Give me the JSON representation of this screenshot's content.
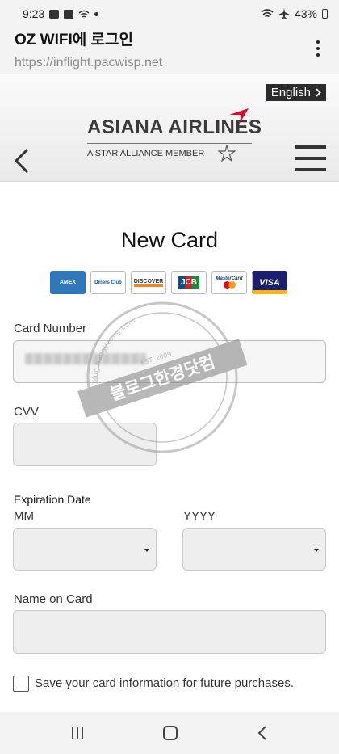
{
  "status_bar": {
    "time": "9:23",
    "battery": "43%"
  },
  "browser": {
    "page_title": "OZ WIFI에 로그인",
    "url": "https://inflight.pacwisp.net"
  },
  "header": {
    "language_label": "English",
    "airline_name": "ASIANA AIRLINES",
    "alliance_text": "A STAR ALLIANCE MEMBER"
  },
  "form": {
    "title": "New Card",
    "card_brands": [
      "AMEX",
      "Diners Club",
      "DISCOVER",
      "JCB",
      "MasterCard",
      "VISA"
    ],
    "card_number_label": "Card Number",
    "cvv_label": "CVV",
    "expiration_label": "Expiration Date",
    "month_label": "MM",
    "year_label": "YYYY",
    "name_label": "Name on Card",
    "save_card_label": "Save your card information for future purchases."
  },
  "watermark": {
    "text": "블로그한경닷컴",
    "arc_text": "http://blog.hangyeong.com",
    "est": "EST. 2009"
  },
  "colors": {
    "accent_red": "#e4002b",
    "field_bg": "#eeeeee",
    "header_dark": "#2b2b2b"
  }
}
